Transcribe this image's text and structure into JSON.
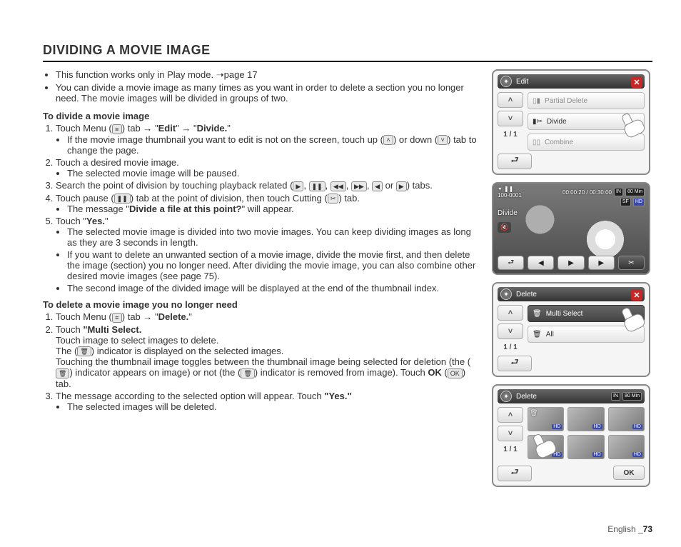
{
  "title": "DIVIDING A MOVIE IMAGE",
  "intro": {
    "b1_a": "This function works only in Play mode. ",
    "b1_b": "page 17",
    "b2": "You can divide a movie image as many times as you want in order to delete a section you no longer need. The movie images will be divided in groups of two."
  },
  "section_divide": {
    "heading": "To divide a movie image",
    "s1_a": "Touch Menu (",
    "s1_b": ") tab → \"",
    "s1_edit": "Edit",
    "s1_c": "\" → \"",
    "s1_divide": "Divide.",
    "s1_d": "\"",
    "s1_sub_a": "If the movie image thumbnail you want to edit is not on the screen, touch up (",
    "s1_sub_b": ") or down (",
    "s1_sub_c": ") tab to change the page.",
    "s2": "Touch a desired movie image.",
    "s2_sub": "The selected movie image will be paused.",
    "s3_a": "Search the point of division by touching playback related (",
    "s3_b": ", ",
    "s3_c": ", ",
    "s3_d": ", ",
    "s3_e": ", ",
    "s3_f": " or ",
    "s3_g": ") tabs.",
    "s4_a": "Touch pause (",
    "s4_b": ")  tab at the point of division, then touch Cutting (",
    "s4_c": ") tab.",
    "s4_sub_a": "The message \"",
    "s4_sub_b": "Divide a file at this point?",
    "s4_sub_c": "\" will appear.",
    "s5_a": "Touch \"",
    "s5_yes": "Yes.",
    "s5_b": "\"",
    "s5_sub1": "The selected movie image is divided into two movie images. You can keep dividing images as long as they are 3 seconds in length.",
    "s5_sub2": "If you want to delete an unwanted section of a movie image, divide the movie first, and then delete the image (section) you no longer need. After dividing the movie image, you can also combine other desired movie images (see page 75).",
    "s5_sub3": "The second image of the divided image will be displayed at the end of the thumbnail index."
  },
  "section_delete": {
    "heading": "To delete a movie image you no longer need",
    "s1_a": "Touch Menu (",
    "s1_b": ") tab → \"",
    "s1_delete": "Delete.",
    "s1_c": "\"",
    "s2_a": "Touch ",
    "s2_b": "\"Multi Select.",
    "s2_line2": "Touch image to select images to delete.",
    "s2_line3_a": "The (",
    "s2_line3_b": ") indicator is displayed on the selected images.",
    "s2_line4_a": "Touching the thumbnail image toggles between the thumbnail image being selected for deletion (the (",
    "s2_line4_b": ") indicator appears on image) or not (the (",
    "s2_line4_c": ") indicator is removed from image). Touch ",
    "s2_ok": "OK",
    "s2_line4_d": " (",
    "s2_line4_e": ") tab.",
    "s3_a": "The message according to the selected option will appear. Touch ",
    "s3_yes": "\"Yes.\"",
    "s3_sub": "The selected images will be deleted."
  },
  "footer": {
    "lang": "English _",
    "page": "73"
  },
  "icons": {
    "menu": "≡",
    "up": "˄",
    "down": "˅",
    "play": "▶",
    "pause": "❚❚",
    "rev": "◀◀",
    "fwd": "▶▶",
    "stepb": "◀",
    "stepf": "▶",
    "cut": "✂",
    "trash": "🗑",
    "ok": "OK"
  },
  "screen1": {
    "title": "Edit",
    "items": [
      "Partial Delete",
      "Divide",
      "Combine"
    ],
    "page": "1 / 1"
  },
  "screen2": {
    "file": "100-0001",
    "time": "00:00:20 / 00:30:00",
    "label": "Divide",
    "in": "IN",
    "bat": "80 Min",
    "sf": "SF",
    "hd": "HD"
  },
  "screen3": {
    "title": "Delete",
    "items": [
      "Multi Select",
      "All"
    ],
    "page": "1 / 1"
  },
  "screen4": {
    "title": "Delete",
    "page": "1 / 1",
    "in": "IN",
    "bat": "80 Min",
    "ok": "OK",
    "hd": "HD"
  }
}
